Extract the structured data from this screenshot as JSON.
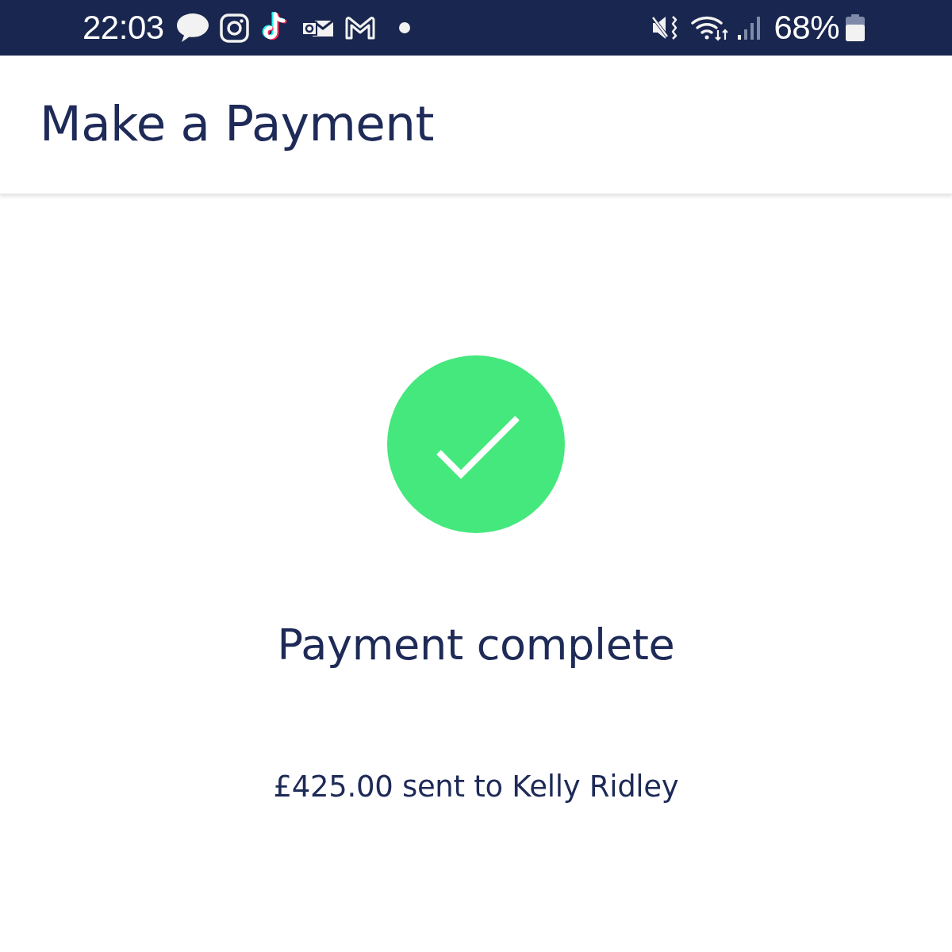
{
  "status_bar": {
    "time": "22:03",
    "battery": "68%"
  },
  "header": {
    "title": "Make a Payment"
  },
  "confirmation": {
    "title": "Payment complete",
    "message": "£425.00 sent to Kelly Ridley"
  }
}
